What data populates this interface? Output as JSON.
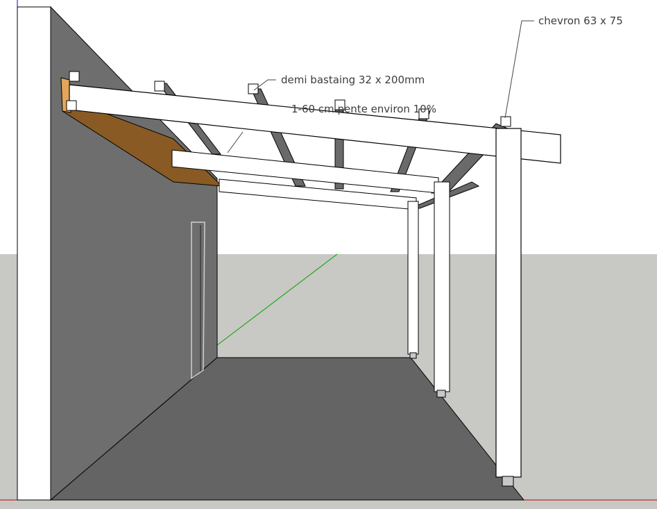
{
  "annotations": {
    "chevron": "chevron 63 x 75",
    "demi_bastaing": "demi bastaing 32 x 200mm",
    "pente": "1-60 cm pente environ 10%"
  },
  "colors": {
    "sky": "#ffffff",
    "ground": "#c8c8c4",
    "wall": "#6e6e6e",
    "floor": "#646464",
    "wood": "#8a5a24",
    "wood_end": "#e3a55a",
    "beam": "#ffffff",
    "axis_red": "#cc0000",
    "axis_green": "#00a000",
    "axis_blue": "#0000cc"
  }
}
